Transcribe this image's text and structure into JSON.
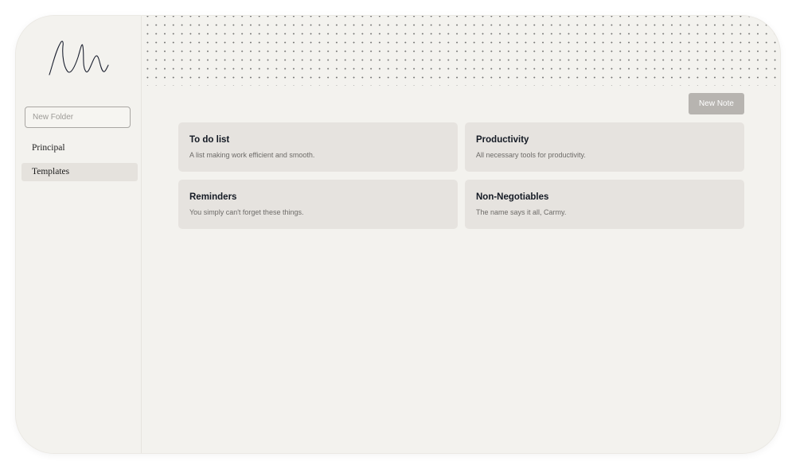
{
  "sidebar": {
    "logo_icon": "signature-logo-icon",
    "new_folder_placeholder": "New Folder",
    "folders": [
      {
        "label": "Principal",
        "active": false
      },
      {
        "label": "Templates",
        "active": true
      }
    ]
  },
  "toolbar": {
    "new_note_label": "New Note"
  },
  "notes": [
    {
      "title": "To do list",
      "description": "A list making work efficient and smooth."
    },
    {
      "title": "Productivity",
      "description": "All necessary tools for productivity."
    },
    {
      "title": "Reminders",
      "description": "You simply can't forget these things."
    },
    {
      "title": "Non-Negotiables",
      "description": "The name says it all, Carmy."
    }
  ],
  "colors": {
    "background": "#f3f2ee",
    "card": "#e6e3df",
    "active_folder": "#e5e2dd",
    "button": "#b7b4b0",
    "title_text": "#141a24"
  }
}
